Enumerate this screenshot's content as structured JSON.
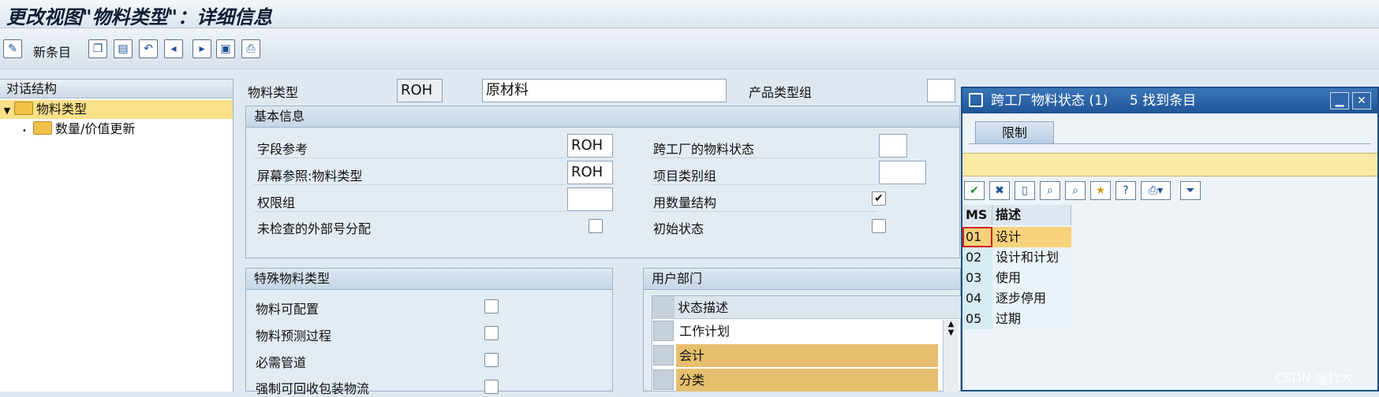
{
  "window": {
    "title": "更改视图\"物料类型\"：详细信息"
  },
  "toolbar": {
    "new_entries_label": "新条目",
    "icons": [
      "glasses-edit-icon",
      "copy-icon",
      "delete-icon",
      "undo-icon",
      "previous-entry-icon",
      "next-entry-icon",
      "select-all-icon",
      "print-icon"
    ]
  },
  "left_panel": {
    "header": "对话结构",
    "items": [
      {
        "label": "物料类型",
        "expanded": true,
        "selected": true
      },
      {
        "label": "数量/价值更新",
        "expanded": false,
        "selected": false
      }
    ]
  },
  "header_fields": {
    "material_type_label": "物料类型",
    "material_type_value": "ROH",
    "material_type_desc": "原材料",
    "product_group_label": "产品类型组",
    "product_group_value": ""
  },
  "basic_info": {
    "title": "基本信息",
    "field_reference_label": "字段参考",
    "field_reference_value": "ROH",
    "screen_ref_label": "屏幕参照:物料类型",
    "screen_ref_value": "ROH",
    "auth_group_label": "权限组",
    "auth_group_value": "",
    "ext_num_label": "未检查的外部号分配",
    "ext_num_checked": false,
    "cross_plant_status_label": "跨工厂的物料状态",
    "cross_plant_status_value": "",
    "item_cat_group_label": "项目类别组",
    "item_cat_group_value": "",
    "qty_structure_label": "用数量结构",
    "qty_structure_checked": true,
    "initial_status_label": "初始状态",
    "initial_status_checked": false
  },
  "special_types": {
    "title": "特殊物料类型",
    "items": [
      {
        "label": "物料可配置",
        "checked": false
      },
      {
        "label": "物料预测过程",
        "checked": false
      },
      {
        "label": "必需管道",
        "checked": false
      },
      {
        "label": "强制可回收包装物流",
        "checked": false
      }
    ]
  },
  "user_dept": {
    "title": "用户部门",
    "column_header": "状态描述",
    "rows": [
      {
        "label": "工作计划",
        "highlighted": false
      },
      {
        "label": "会计",
        "highlighted": true
      },
      {
        "label": "分类",
        "highlighted": true
      }
    ]
  },
  "popup": {
    "title": "跨工厂物料状态 (1)",
    "result_count": "5 找到条目",
    "tab_label": "限制",
    "toolbar_icons": [
      "confirm-icon",
      "cancel-icon",
      "new-icon",
      "find-icon",
      "find-next-icon",
      "add-favorite-icon",
      "help-icon",
      "print-icon",
      "filter-icon"
    ],
    "columns": [
      "MS",
      "描述"
    ],
    "rows": [
      {
        "code": "01",
        "desc": "设计"
      },
      {
        "code": "02",
        "desc": "设计和计划"
      },
      {
        "code": "03",
        "desc": "使用"
      },
      {
        "code": "04",
        "desc": "逐步停用"
      },
      {
        "code": "05",
        "desc": "过期"
      }
    ],
    "colors": {
      "title_bar": "#1f5496",
      "selection": "#f7d27a",
      "yellow_bar": "#fbe9a6"
    }
  },
  "watermark": "CSDN @竹大",
  "colors": {
    "highlight_row": "#e6bf6e",
    "selected_tree": "#fbe08a"
  }
}
